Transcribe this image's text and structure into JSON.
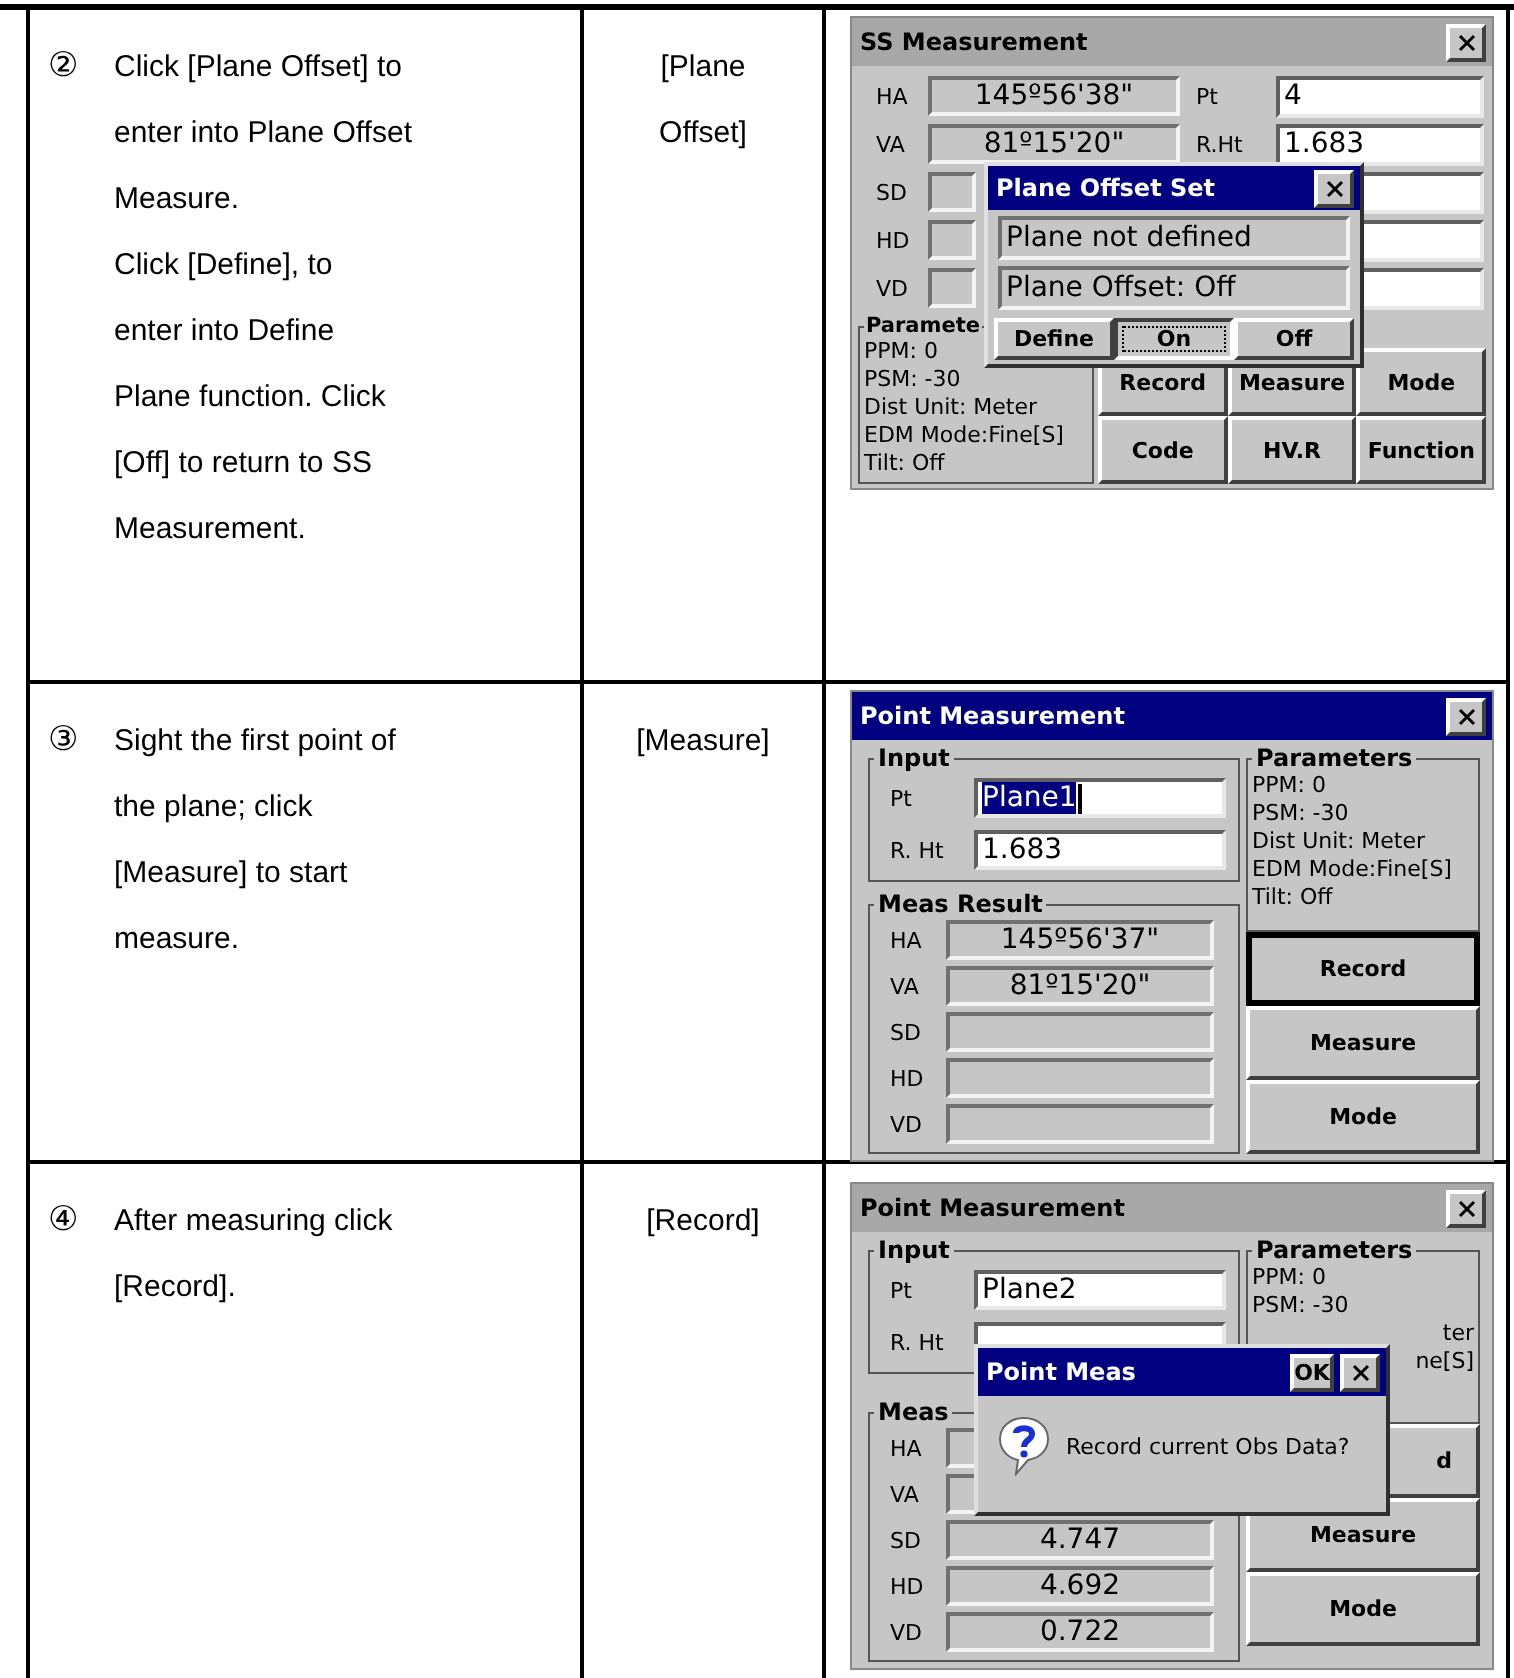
{
  "steps": [
    {
      "number": "②",
      "lines": [
        "Click [Plane Offset] to",
        "enter into Plane Offset",
        "Measure.",
        "Click [Define], to",
        "enter into Define",
        "Plane function. Click",
        "[Off] to return to SS",
        "Measurement."
      ],
      "key": [
        "[Plane",
        "Offset]"
      ],
      "screen": {
        "kind": "ss_measurement",
        "title": "SS Measurement",
        "active": false,
        "left_fields": [
          {
            "label": "HA",
            "value": "145º56'38\""
          },
          {
            "label": "VA",
            "value": "81º15'20\""
          },
          {
            "label": "SD"
          },
          {
            "label": "HD"
          },
          {
            "label": "VD"
          }
        ],
        "right_fields": [
          {
            "label": "Pt",
            "value": "4"
          },
          {
            "label": "R.Ht",
            "value": "1.683"
          }
        ],
        "parameters": {
          "title": "Paramete",
          "lines": [
            "PPM:  0",
            "PSM: -30",
            "Dist Unit: Meter",
            "EDM Mode:Fine[S]",
            "Tilt:  Off"
          ]
        },
        "buttons": [
          "Record",
          "Measure",
          "Mode",
          "Code",
          "HV.R",
          "Function"
        ],
        "dialog": {
          "kind": "plane_offset_set",
          "title": "Plane Offset Set",
          "active": true,
          "status": [
            "Plane not defined",
            "Plane Offset: Off"
          ],
          "buttons": [
            {
              "label": "Define",
              "focused": false
            },
            {
              "label": "On",
              "focused": true
            },
            {
              "label": "Off",
              "focused": false
            }
          ]
        }
      }
    },
    {
      "number": "③",
      "lines": [
        "Sight the first point of",
        "the plane; click",
        "[Measure] to start",
        "measure."
      ],
      "key": [
        "[Measure]"
      ],
      "screen": {
        "kind": "point_measurement",
        "title": "Point Measurement",
        "active": true,
        "input": {
          "title": "Input",
          "fields": [
            {
              "label": "Pt",
              "value": "Plane1",
              "selected": true
            },
            {
              "label": "R. Ht",
              "value": "1.683",
              "selected": false
            }
          ]
        },
        "result": {
          "title": "Meas Result",
          "fields": [
            {
              "label": "HA",
              "value": "145º56'37\""
            },
            {
              "label": "VA",
              "value": "81º15'20\""
            },
            {
              "label": "SD"
            },
            {
              "label": "HD"
            },
            {
              "label": "VD"
            }
          ]
        },
        "parameters": {
          "title": "Parameters",
          "lines": [
            "PPM:  0",
            "PSM: -30",
            "Dist Unit: Meter",
            "EDM Mode:Fine[S]",
            "Tilt:  Off"
          ]
        },
        "buttons": [
          {
            "label": "Record",
            "focused": true,
            "clipped": false
          },
          {
            "label": "Measure",
            "focused": false,
            "clipped": false
          },
          {
            "label": "Mode",
            "focused": false,
            "clipped": false
          }
        ]
      }
    },
    {
      "number": "④",
      "lines": [
        "After measuring click",
        "[Record]."
      ],
      "key": [
        "[Record]"
      ],
      "screen": {
        "kind": "point_measurement",
        "title": "Point Measurement",
        "active": false,
        "input": {
          "title": "Input",
          "fields": [
            {
              "label": "Pt",
              "value": "Plane2",
              "selected": false
            },
            {
              "label": "R. Ht",
              "selected": false
            }
          ]
        },
        "result": {
          "title": "Meas",
          "fields": [
            {
              "label": "HA"
            },
            {
              "label": "VA"
            },
            {
              "label": "SD",
              "value": "4.747"
            },
            {
              "label": "HD",
              "value": "4.692"
            },
            {
              "label": "VD",
              "value": "0.722"
            }
          ]
        },
        "parameters": {
          "title": "Parameters",
          "lines": [
            "PPM:  0",
            "PSM: -30"
          ],
          "clipped_lines": [
            "ter",
            "ne[S]"
          ]
        },
        "buttons": [
          {
            "label": "d",
            "focused": false,
            "clipped": true
          },
          {
            "label": "Measure",
            "focused": false,
            "clipped": false
          },
          {
            "label": "Mode",
            "focused": false,
            "clipped": false
          }
        ],
        "dialog": {
          "kind": "message",
          "title": "Point Meas",
          "active": true,
          "ok": "OK",
          "message": "Record current Obs Data?"
        }
      }
    }
  ]
}
